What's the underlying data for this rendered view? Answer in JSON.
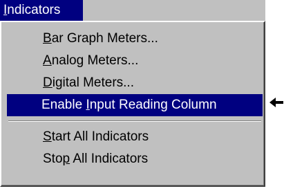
{
  "menu": {
    "title": {
      "mnemonic": "I",
      "rest": "ndicators"
    },
    "items": [
      {
        "pre": "",
        "mnemonic": "B",
        "post": "ar Graph Meters..."
      },
      {
        "pre": "",
        "mnemonic": "A",
        "post": "nalog Meters..."
      },
      {
        "pre": "",
        "mnemonic": "D",
        "post": "igital Meters..."
      },
      {
        "pre": "Enable ",
        "mnemonic": "I",
        "post": "nput Reading Column"
      },
      {
        "pre": "",
        "mnemonic": "S",
        "post": "tart All Indicators"
      },
      {
        "pre": "Sto",
        "mnemonic": "p",
        "post": " All Indicators"
      }
    ],
    "selected_index": 3
  },
  "colors": {
    "menu_background": "#c0c0c0",
    "highlight": "#000080",
    "highlight_text": "#ffffff"
  },
  "icons": {
    "pointer": "left-arrow-icon"
  }
}
